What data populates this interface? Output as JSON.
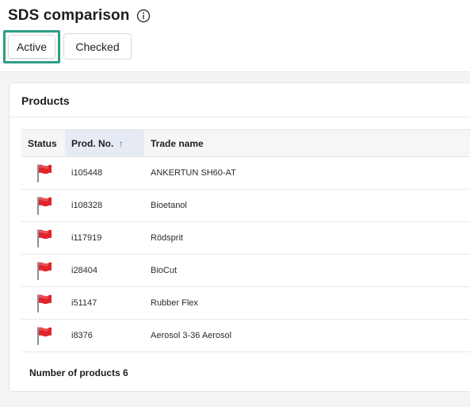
{
  "header": {
    "title": "SDS comparison",
    "info_icon": "info-icon"
  },
  "tabs": [
    {
      "label": "Active",
      "selected": true
    },
    {
      "label": "Checked",
      "selected": false
    }
  ],
  "panel": {
    "title": "Products",
    "columns": [
      {
        "label": "Status"
      },
      {
        "label": "Prod. No.",
        "sort": "ascending"
      },
      {
        "label": "Trade name"
      }
    ],
    "rows": [
      {
        "status_icon": "red-flag-icon",
        "prod_no": "i105448",
        "trade_name": "ANKERTUN SH60-AT"
      },
      {
        "status_icon": "red-flag-icon",
        "prod_no": "i108328",
        "trade_name": "Bioetanol"
      },
      {
        "status_icon": "red-flag-icon",
        "prod_no": "i117919",
        "trade_name": "Rödsprit"
      },
      {
        "status_icon": "red-flag-icon",
        "prod_no": "i28404",
        "trade_name": "BioCut"
      },
      {
        "status_icon": "red-flag-icon",
        "prod_no": "i51147",
        "trade_name": "Rubber Flex"
      },
      {
        "status_icon": "red-flag-icon",
        "prod_no": "i8376",
        "trade_name": "Aerosol 3-36 Aerosol"
      }
    ],
    "footer": "Number of products 6"
  },
  "colors": {
    "accent": "#2e9e86",
    "sort_arrow": "#2a7bd6",
    "flag": "#e0242b"
  }
}
